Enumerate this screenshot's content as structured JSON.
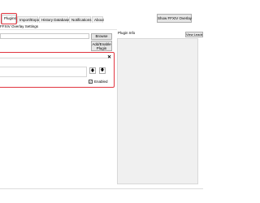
{
  "tabs": [
    {
      "label": "Plugins",
      "active": true
    },
    {
      "label": "Import/Export",
      "active": false
    },
    {
      "label": "History Database",
      "active": false
    },
    {
      "label": "Notifications",
      "active": false
    },
    {
      "label": "About",
      "active": false
    }
  ],
  "show_overlay_button": "Show FFXIV Overlay",
  "subtitle": "FFXIV Overlay Settings",
  "browse_button": "Browse",
  "add_enable_line1": "Add/Enable",
  "add_enable_line2": "Plugin",
  "plugin_info_label": "Plugin Info",
  "view_leaderboard_button": "View Leade",
  "plugin_entry": {
    "close_glyph": "✕",
    "up_glyph": "🡅",
    "down_glyph": "🡇",
    "enabled_label": "Enabled",
    "enabled": true,
    "check_glyph": "✓"
  },
  "colors": {
    "highlight": "#e1353f"
  }
}
